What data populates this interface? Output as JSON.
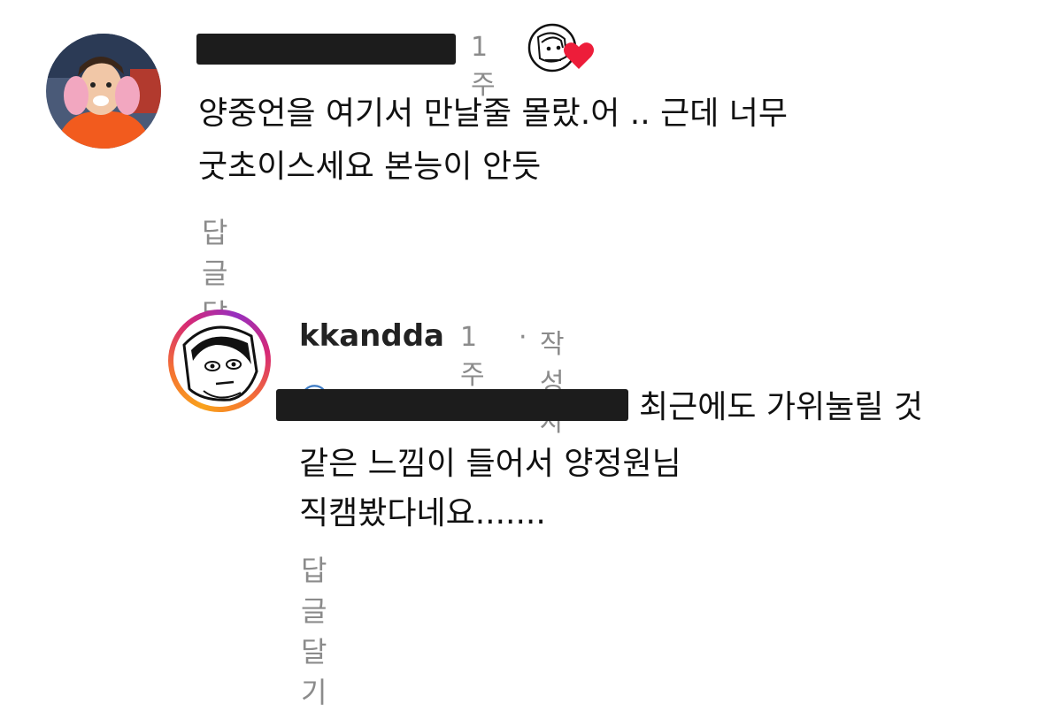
{
  "comments": [
    {
      "time": "1주",
      "text_lines": [
        "양중언을 여기서 만날줄 몰랐.어 .. 근데 너무",
        "굿초이스세요 본능이 안듯"
      ],
      "reply_label": "답글 달기",
      "liked_by_author": true,
      "icons": [
        "profile-avatar",
        "author-liked-heart-icon"
      ]
    },
    {
      "username": "kkandda",
      "time": "1주",
      "separator": "·",
      "author_badge": "작성자",
      "mention_visible_fragment": "@",
      "text_lines": [
        "최근에도 가위눌릴 것",
        "같은 느낌이 들어서 양정원님",
        "직캠봤다네요......."
      ],
      "reply_label": "답글 달기",
      "story_ring": true
    }
  ],
  "colors": {
    "meta_gray": "#8b8b8b",
    "heart_red": "#ed1d3a",
    "mention_blue": "#3f7cc4",
    "redaction": "#1c1c1c"
  }
}
